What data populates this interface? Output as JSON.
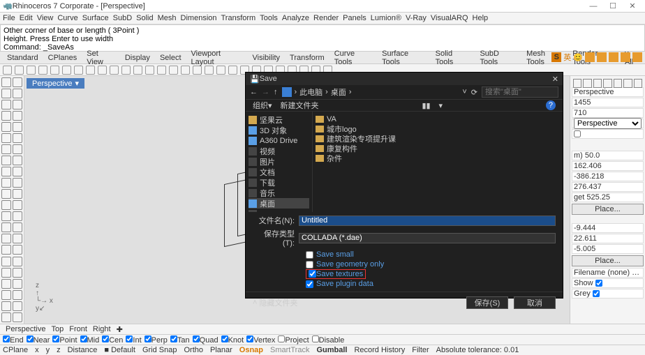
{
  "window": {
    "title": "Rhinoceros 7 Corporate - [Perspective]"
  },
  "menubar": [
    "File",
    "Edit",
    "View",
    "Curve",
    "Surface",
    "SubD",
    "Solid",
    "Mesh",
    "Dimension",
    "Transform",
    "Tools",
    "Analyze",
    "Render",
    "Panels",
    "Lumion®",
    "V-Ray",
    "VisualARQ",
    "Help"
  ],
  "command_lines": [
    "Other corner of base or length ( 3Point )",
    "Height. Press Enter to use width",
    "Command: _SaveAs"
  ],
  "command_prompt": "Command:",
  "tabs": [
    "Standard",
    "CPlanes",
    "Set View",
    "Display",
    "Select",
    "Viewport Layout",
    "Visibility",
    "Transform",
    "Curve Tools",
    "Surface Tools",
    "Solid Tools",
    "SubD Tools",
    "Mesh Tools",
    "Render Tools",
    "y All"
  ],
  "viewport": {
    "tab": "Perspective",
    "axes": [
      "x",
      "y",
      "z"
    ]
  },
  "bottom_tabs": [
    "Perspective",
    "Top",
    "Front",
    "Right"
  ],
  "check_options": [
    {
      "label": "End",
      "checked": true
    },
    {
      "label": "Near",
      "checked": true
    },
    {
      "label": "Point",
      "checked": true
    },
    {
      "label": "Mid",
      "checked": true
    },
    {
      "label": "Cen",
      "checked": true
    },
    {
      "label": "Int",
      "checked": true
    },
    {
      "label": "Perp",
      "checked": true
    },
    {
      "label": "Tan",
      "checked": true
    },
    {
      "label": "Quad",
      "checked": true
    },
    {
      "label": "Knot",
      "checked": true
    },
    {
      "label": "Vertex",
      "checked": true
    },
    {
      "label": "Project",
      "checked": false
    },
    {
      "label": "Disable",
      "checked": false
    }
  ],
  "status": {
    "items": [
      "CPlane",
      "x",
      "y",
      "z",
      "Distance",
      "■ Default",
      "Grid Snap",
      "Ortho",
      "Planar"
    ],
    "osnap": "Osnap",
    "smart": "SmartTrack",
    "gumball": "Gumball",
    "rest": [
      "Record History",
      "Filter",
      "Absolute tolerance: 0.01"
    ]
  },
  "right_panel": {
    "title": "Perspective",
    "v1": "1455",
    "v2": "710",
    "mode": "Perspective",
    "coords_label_m": "m)",
    "coords": [
      "50.0",
      "162.406",
      "-386.218",
      "276.437"
    ],
    "get_label": "get",
    "get_val": "525.25",
    "place": "Place...",
    "coords2": [
      "-9.444",
      "22.611",
      "-5.005"
    ],
    "filename_label": "Filename",
    "filename_val": "(none)",
    "show_label": "Show",
    "grey_label": "Grey"
  },
  "dialog": {
    "title": "Save",
    "crumbs": [
      "此电脑",
      "桌面"
    ],
    "search_placeholder": "搜索\"桌面\"",
    "org": "组织▾",
    "newfolder": "新建文件夹",
    "tree": [
      {
        "label": "坚果云",
        "icon": "#d4a94f"
      },
      {
        "label": "3D 对象",
        "icon": "#5a9fe6"
      },
      {
        "label": "A360 Drive",
        "icon": "#5a9fe6"
      },
      {
        "label": "视频",
        "icon": "#444"
      },
      {
        "label": "图片",
        "icon": "#444"
      },
      {
        "label": "文档",
        "icon": "#444"
      },
      {
        "label": "下载",
        "icon": "#444"
      },
      {
        "label": "音乐",
        "icon": "#444"
      },
      {
        "label": "桌面",
        "icon": "#5a9fe6",
        "selected": true
      },
      {
        "label": "...",
        "icon": "#444"
      }
    ],
    "files": [
      "VA",
      "城市logo",
      "建筑渲染专项提升课",
      "康复构件",
      "杂件"
    ],
    "filename_label": "文件名(N):",
    "filename": "Untitled",
    "type_label": "保存类型(T):",
    "type": "COLLADA (*.dae)",
    "opts": [
      {
        "label": "Save small",
        "checked": false
      },
      {
        "label": "Save geometry only",
        "checked": false
      },
      {
        "label": "Save textures",
        "checked": true,
        "red": true
      },
      {
        "label": "Save plugin data",
        "checked": true
      }
    ],
    "hide": "隐藏文件夹",
    "save_btn": "保存(S)",
    "cancel_btn": "取消"
  },
  "chart_data": null
}
